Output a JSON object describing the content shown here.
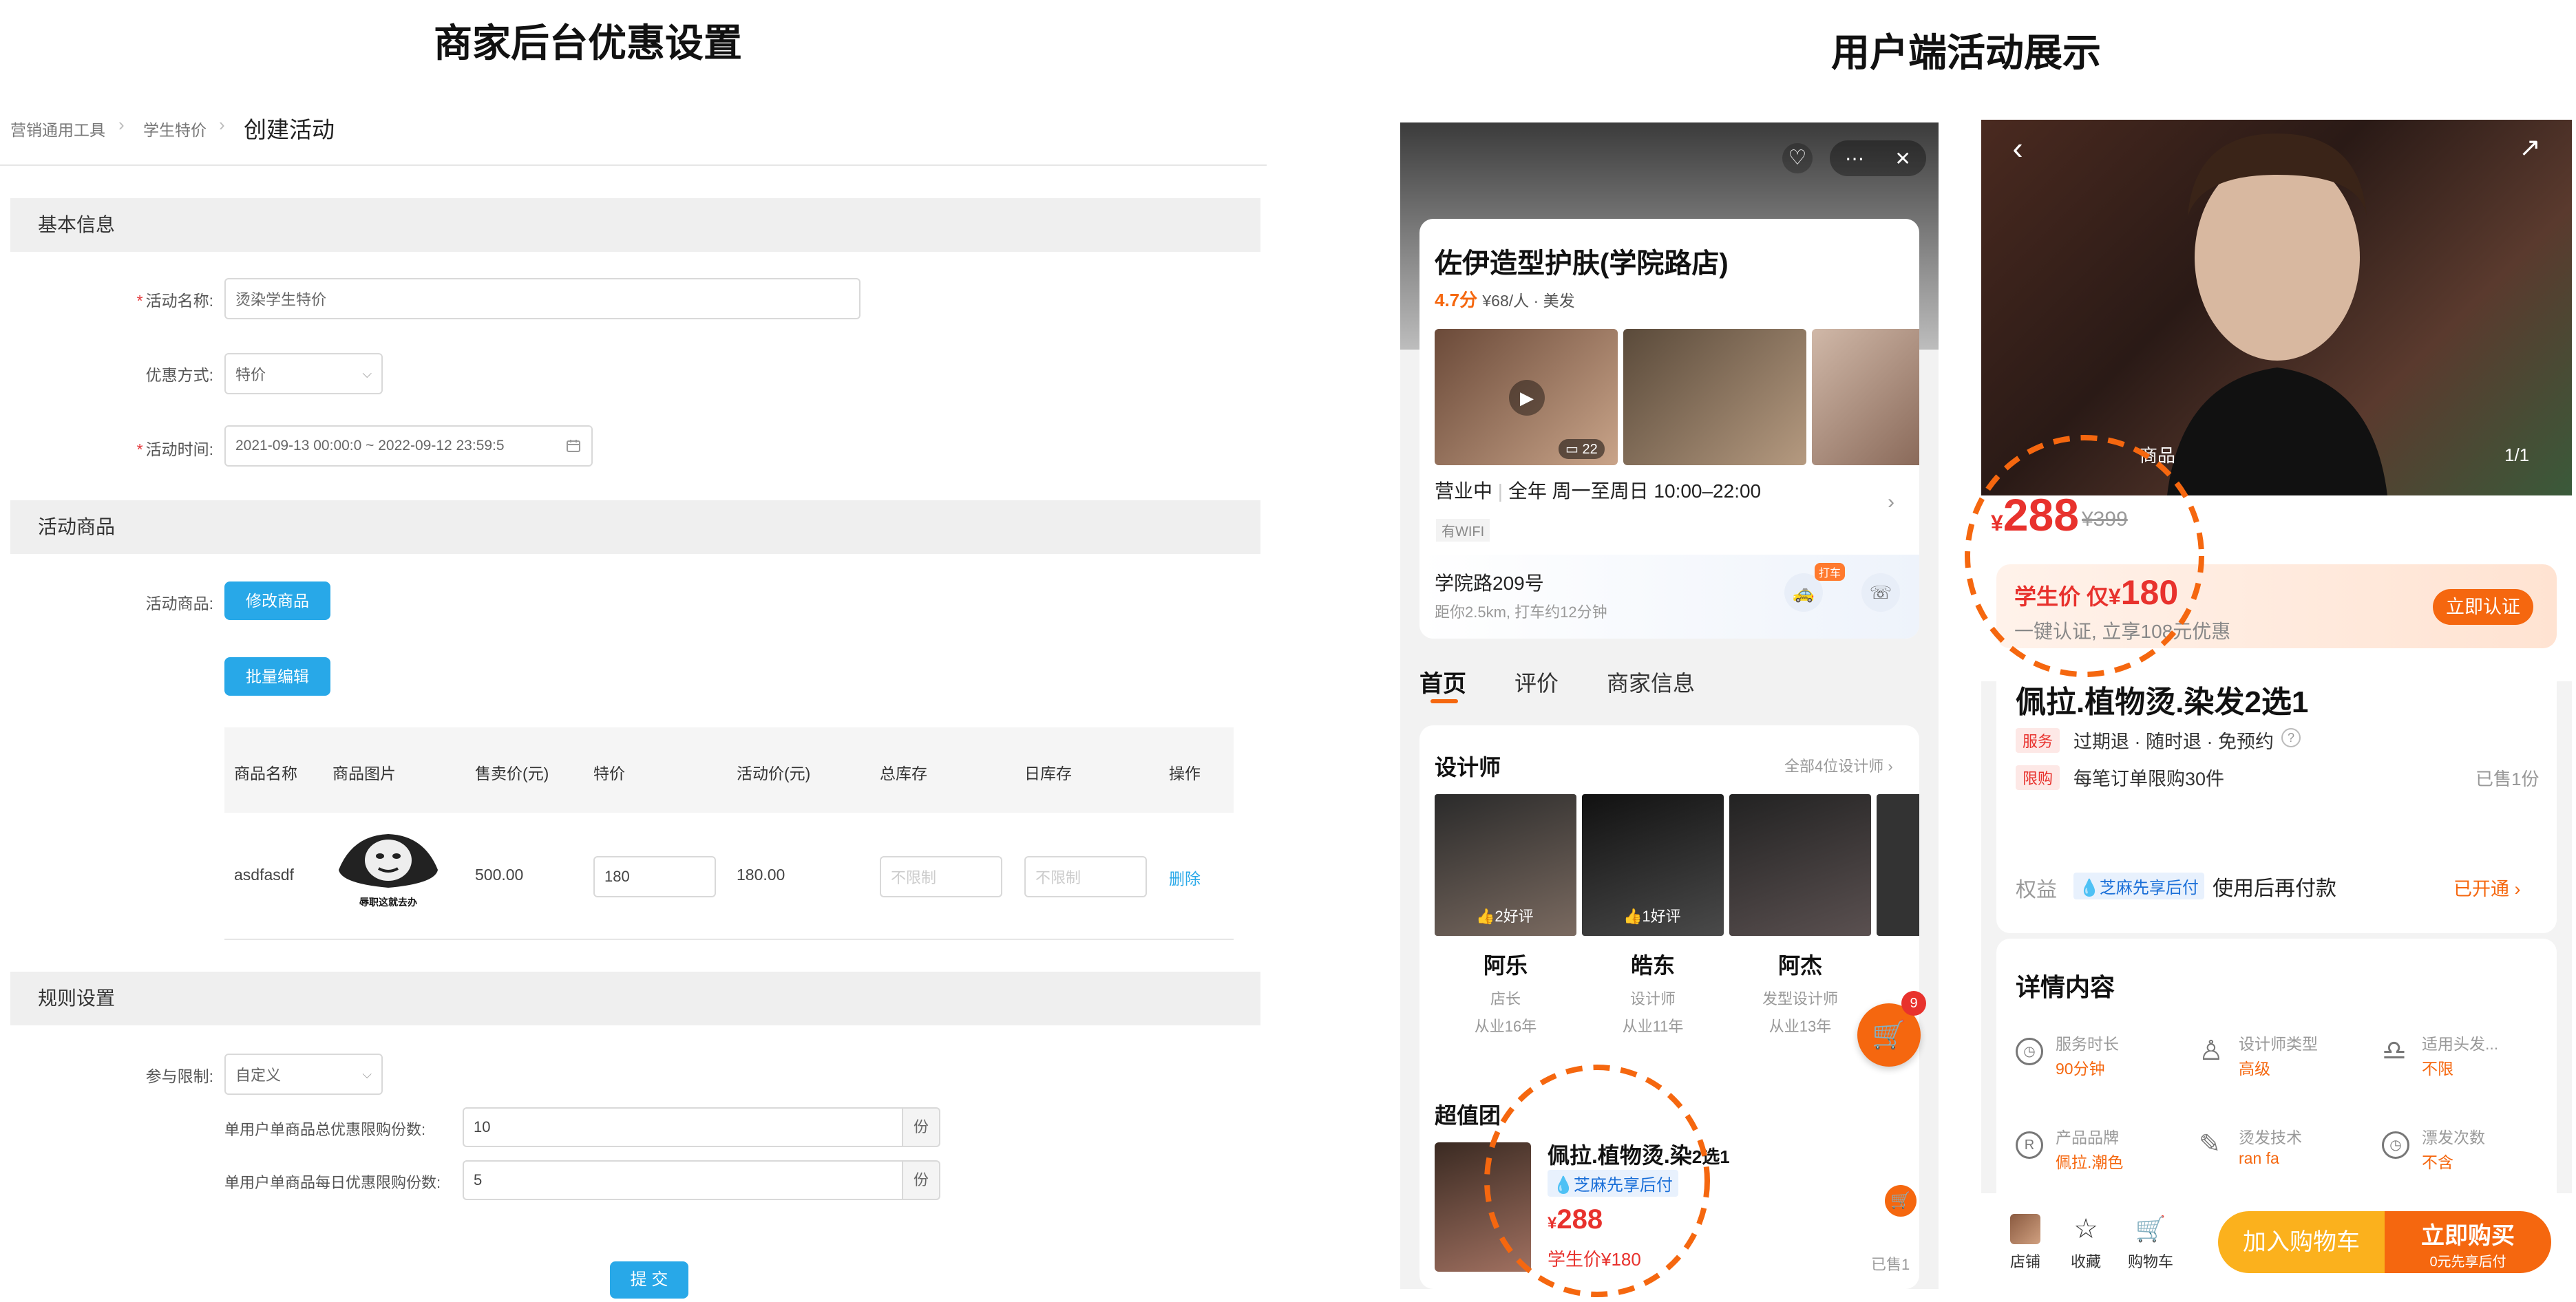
{
  "left_title": "商家后台优惠设置",
  "right_title": "用户端活动展示",
  "admin": {
    "breadcrumb": [
      "营销通用工具",
      "学生特价",
      "创建活动"
    ],
    "sections": {
      "basic": "基本信息",
      "goods": "活动商品",
      "rules": "规则设置"
    },
    "basic": {
      "name_label": "活动名称:",
      "name_value": "烫染学生特价",
      "mode_label": "优惠方式:",
      "mode_value": "特价",
      "time_label": "活动时间:",
      "time_value": "2021-09-13 00:00:0 ~ 2022-09-12 23:59:5"
    },
    "goods": {
      "label": "活动商品:",
      "modify_button": "修改商品",
      "batch_button": "批量编辑",
      "columns": [
        "商品名称",
        "商品图片",
        "售卖价(元)",
        "特价",
        "活动价(元)",
        "总库存",
        "日库存",
        "操作"
      ],
      "row": {
        "name": "asdfasdf",
        "image_caption": "辱职这就去办",
        "price": "500.00",
        "special": "180",
        "activity_price": "180.00",
        "total_stock_placeholder": "不限制",
        "daily_stock_placeholder": "不限制",
        "action": "删除"
      }
    },
    "rules": {
      "limit_label": "参与限制:",
      "limit_value": "自定义",
      "total_label": "单用户单商品总优惠限购份数:",
      "total_value": "10",
      "daily_label": "单用户单商品每日优惠限购份数:",
      "daily_value": "5",
      "unit": "份"
    },
    "submit": "提 交"
  },
  "store": {
    "name": "佐伊造型护肤(学院路店)",
    "rating": "4.7分",
    "meta": "¥68/人 · 美发",
    "photo_count": "22",
    "status": "营业中",
    "hours": "全年 周一至周日 10:00–22:00",
    "wifi": "有WIFI",
    "address": "学院路209号",
    "distance": "距你2.5km, 打车约12分钟",
    "taxi_badge": "打车",
    "tabs": [
      "首页",
      "评价",
      "商家信息"
    ],
    "designers_title": "设计师",
    "designers_all": "全部4位设计师",
    "designers": [
      {
        "name": "阿乐",
        "role": "店长",
        "years": "从业16年",
        "likes": "2好评"
      },
      {
        "name": "皓东",
        "role": "设计师",
        "years": "从业11年",
        "likes": "1好评"
      },
      {
        "name": "阿杰",
        "role": "发型设计师",
        "years": "从业13年",
        "likes": ""
      }
    ],
    "cart_badge": "9",
    "deal_section": "超值团",
    "deal_title": "佩拉.植物烫.染",
    "deal_suffix": "2选1",
    "deal_tag": "芝麻先享后付",
    "deal_price": "288",
    "deal_student": "学生价¥180",
    "deal_sold": "已售1"
  },
  "product": {
    "image_tag": "商品",
    "image_index": "1/1",
    "price": "288",
    "orig_price": "¥399",
    "student_prefix": "学生价 仅¥",
    "student_price": "180",
    "student_sub": "一键认证, 立享108元优惠",
    "verify_button": "立即认证",
    "title": "佩拉.植物烫.染发2选1",
    "service_tag": "服务",
    "service_text": "过期退 · 随时退 · 免预约",
    "limit_tag": "限购",
    "limit_text": "每笔订单限购30件",
    "sold": "已售1份",
    "rights_label": "权益",
    "rights_tag": "芝麻先享后付",
    "rights_text": "使用后再付款",
    "rights_status": "已开通",
    "detail_title": "详情内容",
    "details": [
      {
        "label": "服务时长",
        "value": "90分钟",
        "icon": "clock-icon"
      },
      {
        "label": "设计师类型",
        "value": "高级",
        "icon": "person-icon"
      },
      {
        "label": "适用头发...",
        "value": "不限",
        "icon": "hair-icon"
      },
      {
        "label": "产品品牌",
        "value": "佩拉.潮色",
        "icon": "brand-icon"
      },
      {
        "label": "烫发技术",
        "value": "ran fa",
        "icon": "brush-icon"
      },
      {
        "label": "漂发次数",
        "value": "不含",
        "icon": "clock-icon"
      }
    ],
    "bottom_nav": [
      "店铺",
      "收藏",
      "购物车"
    ],
    "add_cart": "加入购物车",
    "buy_now": "立即购买",
    "buy_sub": "0元先享后付"
  },
  "colors": {
    "accent": "#f5670f",
    "blue": "#28a8e8",
    "red": "#e8322d"
  }
}
